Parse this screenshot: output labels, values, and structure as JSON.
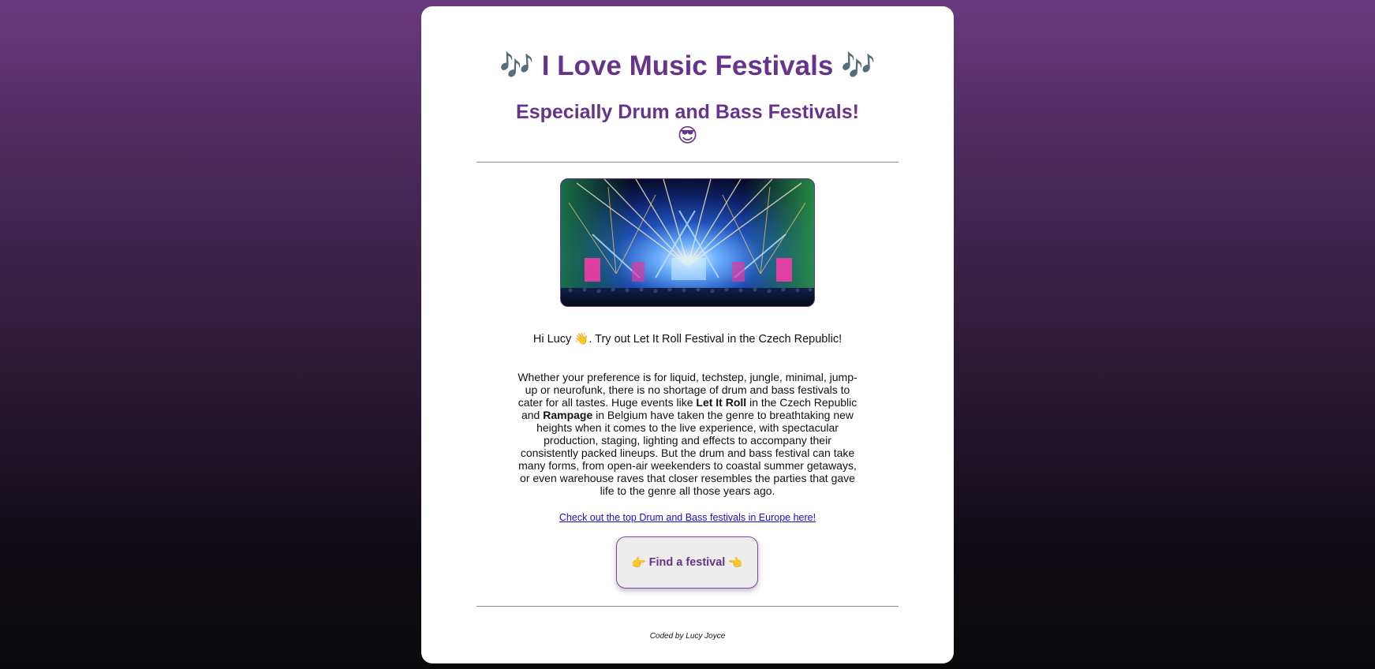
{
  "header": {
    "title_prefix_icon": "🎶",
    "title": "I Love Music Festivals",
    "title_suffix_icon": "🎶",
    "subtitle_pre": "Especially ",
    "subtitle_bold": "Drum and Bass",
    "subtitle_post": " Festivals!",
    "subtitle_emoji": "😎"
  },
  "hero_image": {
    "alt": "festival stage with lights"
  },
  "greeting": {
    "pre": "Hi Lucy ",
    "emoji": "👋",
    "post": ". Try out Let It Roll Festival in the Czech Republic!"
  },
  "body": {
    "part1": "Whether your preference is for liquid, techstep, jungle, minimal, jump-up or neurofunk, there is no shortage of drum and bass festivals to cater for all tastes. Huge events like ",
    "bold1": "Let It Roll",
    "part2": " in the Czech Republic and ",
    "bold2": "Rampage",
    "part3": " in Belgium have taken the genre to breathtaking new heights when it comes to the live experience, with spectacular production, staging, lighting and effects to accompany their consistently packed lineups. But the drum and bass festival can take many forms, from open-air weekenders to coastal summer getaways, or even warehouse raves that closer resembles the parties that gave life to the genre all those years ago."
  },
  "link": {
    "text": "Check out the top Drum and Bass festivals in Europe here!"
  },
  "cta": {
    "left_icon": "👉",
    "label": "Find a festival",
    "right_icon": "👈"
  },
  "footer": {
    "credit": "Coded by Lucy Joyce"
  },
  "colors": {
    "accent": "#66348a",
    "link": "#1a0dcc",
    "card": "#ffffff"
  }
}
